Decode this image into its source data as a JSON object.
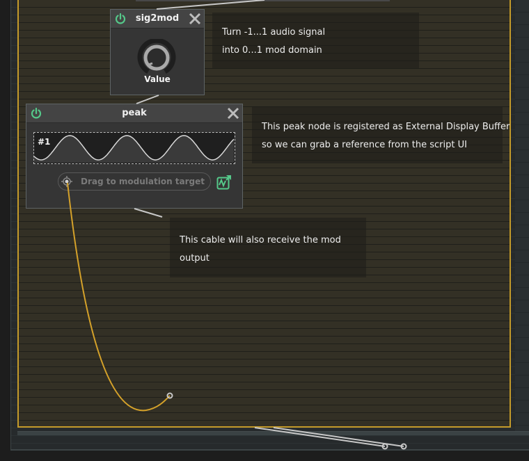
{
  "colors": {
    "accent": "#c39a2a",
    "power": "#55c98a",
    "cable_mod": "#d4a12a",
    "cable_audio": "#c8c8c8"
  },
  "nodes": {
    "sig2mod": {
      "title": "sig2mod",
      "power_icon": "power-icon",
      "close_icon": "close-icon",
      "knob": {
        "label": "Value",
        "icon": "knob-icon"
      }
    },
    "peak": {
      "title": "peak",
      "power_icon": "power-icon",
      "close_icon": "close-icon",
      "display": {
        "id_label": "#1",
        "waveform": "sine",
        "cycles": 3.5
      },
      "drag_target": {
        "label": "Drag to modulation target",
        "icon": "crosshair-icon"
      },
      "mod_output_icon": "modulation-output-icon"
    }
  },
  "comments": [
    {
      "lines": [
        "Turn -1...1 audio signal",
        "into 0...1 mod domain"
      ]
    },
    {
      "lines": [
        "This peak node is registered as External Display Buffer",
        "so we can grab a reference from the script UI"
      ]
    },
    {
      "lines": [
        "This cable will also receive the mod",
        "output"
      ]
    }
  ]
}
